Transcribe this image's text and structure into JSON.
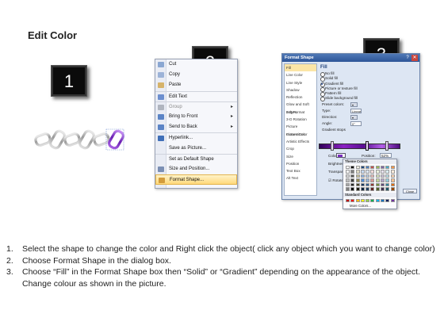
{
  "title": "Edit Color",
  "steps": [
    "1",
    "2",
    "3"
  ],
  "chain": {
    "link_color": "#b9b9b9",
    "highlight_color": "#7a2fbf",
    "link_count": 6
  },
  "context_menu": {
    "items": [
      {
        "label": "Cut",
        "icon": "scissors-icon",
        "color": "#8aa7d2"
      },
      {
        "label": "Copy",
        "icon": "copy-icon",
        "color": "#9cb3d8"
      },
      {
        "label": "Paste",
        "icon": "paste-icon",
        "color": "#d6b36a"
      },
      {
        "label": "Edit Text",
        "icon": "edit-text-icon",
        "color": "#6d8fcf",
        "sep": true
      },
      {
        "label": "Group",
        "icon": "group-icon",
        "color": "#b0b5bf",
        "disabled": true,
        "submenu": true,
        "sep": true
      },
      {
        "label": "Bring to Front",
        "icon": "bring-front-icon",
        "color": "#5b84c6",
        "submenu": true
      },
      {
        "label": "Send to Back",
        "icon": "send-back-icon",
        "color": "#5b84c6",
        "submenu": true
      },
      {
        "label": "Hyperlink...",
        "icon": "hyperlink-icon",
        "color": "#3f6fb8",
        "sep": true
      },
      {
        "label": "Save as Picture...",
        "icon": "",
        "color": ""
      },
      {
        "label": "Set as Default Shape",
        "icon": "",
        "color": "",
        "sep": true
      },
      {
        "label": "Size and Position...",
        "icon": "size-icon",
        "color": "#7b8fb4"
      },
      {
        "label": "Format Shape...",
        "icon": "format-shape-icon",
        "color": "#d39c3c",
        "highlighted": true
      }
    ]
  },
  "dialog": {
    "title": "Format Shape",
    "categories": [
      "Fill",
      "Line Color",
      "Line Style",
      "Shadow",
      "Reflection",
      "Glow and Soft Edges",
      "3-D Format",
      "3-D Rotation",
      "Picture Corrections",
      "Picture Color",
      "Artistic Effects",
      "Crop",
      "Size",
      "Position",
      "Text Box",
      "Alt Text"
    ],
    "selected_category": "Fill",
    "fill_heading": "Fill",
    "fill_options": [
      "No fill",
      "Solid fill",
      "Gradient fill",
      "Picture or texture fill",
      "Pattern fill",
      "Slide background fill"
    ],
    "selected_fill": "Gradient fill",
    "fields": {
      "preset": "Preset colors:",
      "type": "Type:",
      "type_value": "Linear",
      "direction": "Direction:",
      "angle": "Angle:",
      "angle_value": "0°",
      "stops": "Gradient stops",
      "color": "Color",
      "position": "Position:",
      "position_value": "52%",
      "brightness": "Brightness",
      "transparency": "Transparency",
      "rotate": "Rotate with shape"
    },
    "close_label": "Close"
  },
  "palette": {
    "theme_label": "Theme Colors",
    "standard_label": "Standard Colors",
    "more_label": "More Colors...",
    "theme_colors": [
      "#ffffff",
      "#000000",
      "#eeece1",
      "#1f497d",
      "#4f81bd",
      "#c0504d",
      "#9bbb59",
      "#8064a2",
      "#4bacc6",
      "#f79646",
      "#f2f2f2",
      "#7f7f7f",
      "#ddd9c3",
      "#c6d9f0",
      "#dbe5f1",
      "#f2dcdb",
      "#ebf1dd",
      "#e5e0ec",
      "#dbeef3",
      "#fdeada",
      "#d8d8d8",
      "#595959",
      "#c4bd97",
      "#8db3e2",
      "#b8cce4",
      "#e5b9b7",
      "#d7e3bc",
      "#ccc1d9",
      "#b7dde8",
      "#fbd5b5",
      "#bfbfbf",
      "#3f3f3f",
      "#938953",
      "#548dd4",
      "#95b3d7",
      "#d99694",
      "#c3d69b",
      "#b2a2c7",
      "#92cddc",
      "#fac08f",
      "#a5a5a5",
      "#262626",
      "#494429",
      "#17365d",
      "#366092",
      "#953734",
      "#76923c",
      "#5f497a",
      "#31859b",
      "#e36c09",
      "#7f7f7f",
      "#0c0c0c",
      "#1d1b10",
      "#0f243e",
      "#244061",
      "#632423",
      "#4f6128",
      "#3f3151",
      "#205867",
      "#974806"
    ],
    "standard_colors": [
      "#c00000",
      "#ff0000",
      "#ffc000",
      "#ffff00",
      "#92d050",
      "#00b050",
      "#00b0f0",
      "#0070c0",
      "#002060",
      "#7030a0"
    ]
  },
  "instructions": [
    {
      "num": "1.",
      "text": "Select the shape to change the color and Right click the object( click any object which you want to change color)"
    },
    {
      "num": "2.",
      "text": "Choose Format Shape in the dialog box."
    },
    {
      "num": "3.",
      "text": "Choose “Fill” in the Format Shape box then “Solid” or “Gradient” depending on the appearance of the object. Change colour as shown in the picture."
    }
  ]
}
